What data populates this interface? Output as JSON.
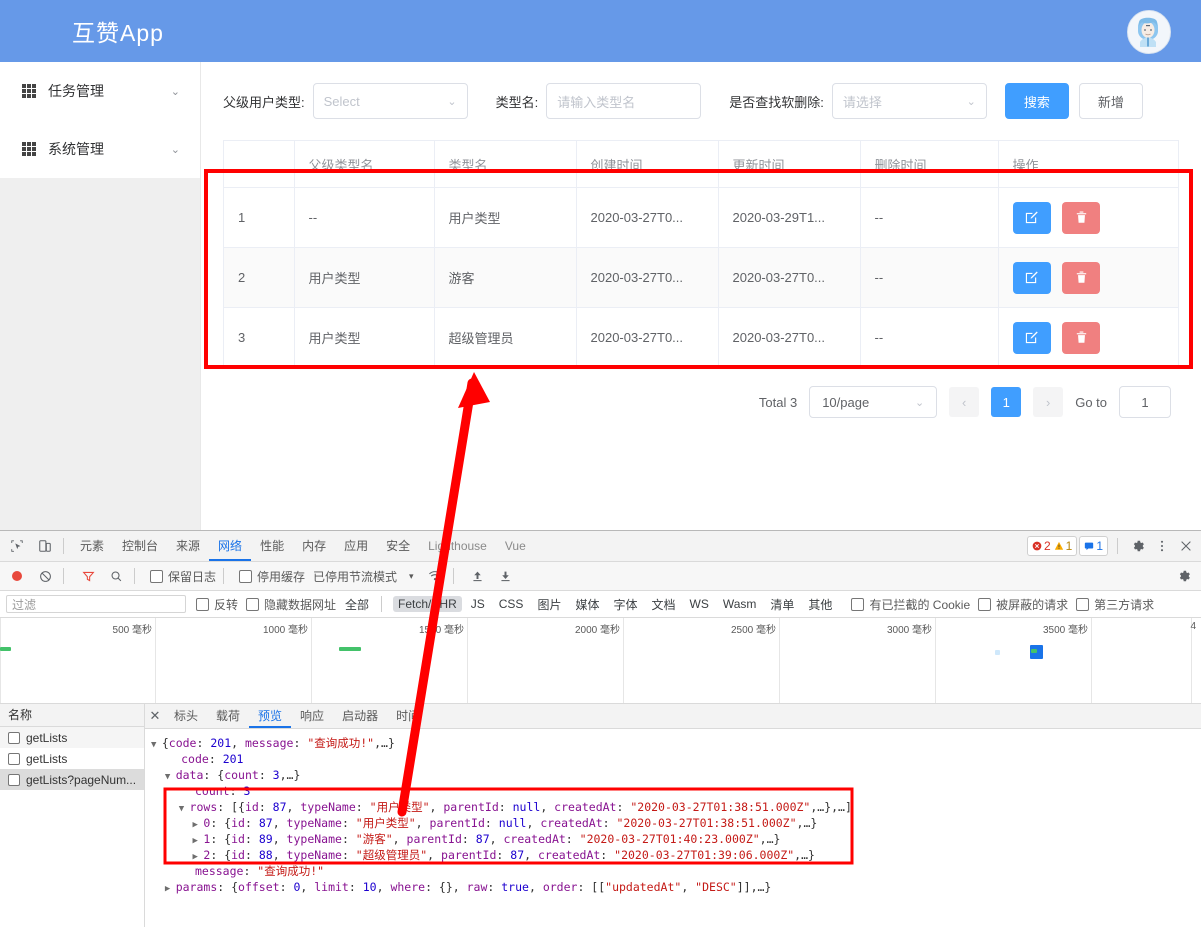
{
  "app": {
    "title": "互赞App",
    "avatar_icon": "user-avatar-icon"
  },
  "sidebar": {
    "items": [
      {
        "label": "任务管理",
        "icon": "grid-icon",
        "arrow": "⌄"
      },
      {
        "label": "系统管理",
        "icon": "grid-icon",
        "arrow": "⌄"
      }
    ]
  },
  "filters": {
    "parent_type_label": "父级用户类型:",
    "parent_type_value": "Select",
    "type_name_label": "类型名:",
    "type_name_placeholder": "请输入类型名",
    "soft_delete_label": "是否查找软删除:",
    "soft_delete_value": "请选择",
    "search_button": "搜索",
    "add_button": "新增"
  },
  "table": {
    "headers": [
      "",
      "父级类型名",
      "类型名",
      "创建时间",
      "更新时间",
      "删除时间",
      "操作"
    ],
    "rows": [
      {
        "idx": "1",
        "parent": "--",
        "name": "用户类型",
        "created": "2020-03-27T0...",
        "updated": "2020-03-29T1...",
        "deleted": "--"
      },
      {
        "idx": "2",
        "parent": "用户类型",
        "name": "游客",
        "created": "2020-03-27T0...",
        "updated": "2020-03-27T0...",
        "deleted": "--"
      },
      {
        "idx": "3",
        "parent": "用户类型",
        "name": "超级管理员",
        "created": "2020-03-27T0...",
        "updated": "2020-03-27T0...",
        "deleted": "--"
      }
    ],
    "edit_icon": "edit-icon",
    "delete_icon": "trash-icon"
  },
  "pagination": {
    "total": "Total 3",
    "page_size": "10/page",
    "prev": "‹",
    "current_page": "1",
    "next": "›",
    "goto_label": "Go to",
    "goto_value": "1"
  },
  "devtools": {
    "tabs": [
      {
        "label": "元素",
        "active": false,
        "muted": false
      },
      {
        "label": "控制台",
        "active": false,
        "muted": false
      },
      {
        "label": "来源",
        "active": false,
        "muted": false
      },
      {
        "label": "网络",
        "active": true,
        "muted": false
      },
      {
        "label": "性能",
        "active": false,
        "muted": false
      },
      {
        "label": "内存",
        "active": false,
        "muted": false
      },
      {
        "label": "应用",
        "active": false,
        "muted": false
      },
      {
        "label": "安全",
        "active": false,
        "muted": false
      },
      {
        "label": "Lighthouse",
        "active": false,
        "muted": true
      },
      {
        "label": "Vue",
        "active": false,
        "muted": true
      }
    ],
    "badges": {
      "errors": "2",
      "warnings": "1",
      "messages": "1"
    },
    "icons": {
      "inspect": "inspect-element-icon",
      "device": "device-toolbar-icon",
      "settings": "gear-icon",
      "more": "kebab-menu-icon",
      "close": "close-icon",
      "record": "record-icon",
      "clear": "clear-icon",
      "filter": "filter-icon",
      "search": "search-icon",
      "throttle": "network-conditions-icon",
      "import": "import-har-icon",
      "export": "export-har-icon",
      "panel_settings": "gear-icon"
    },
    "controls": {
      "preserve_log": "保留日志",
      "disable_cache": "停用缓存",
      "throttling": "已停用节流模式",
      "throttle_caret": "▾"
    },
    "filterbar": {
      "filter_placeholder": "过滤",
      "invert": "反转",
      "hide_data_urls": "隐藏数据网址",
      "types": [
        "全部",
        "Fetch/XHR",
        "JS",
        "CSS",
        "图片",
        "媒体",
        "字体",
        "文档",
        "WS",
        "Wasm",
        "清单",
        "其他"
      ],
      "selected_type": "Fetch/XHR",
      "blocked_cookies": "有已拦截的 Cookie",
      "blocked_requests": "被屏蔽的请求",
      "third_party": "第三方请求"
    },
    "timeline": {
      "labels": [
        "500 毫秒",
        "1000 毫秒",
        "1500 毫秒",
        "2000 毫秒",
        "2500 毫秒",
        "3000 毫秒",
        "3500 毫秒",
        "4"
      ]
    },
    "requests": {
      "header": "名称",
      "items": [
        {
          "name": "getLists",
          "selected": false
        },
        {
          "name": "getLists",
          "selected": false
        },
        {
          "name": "getLists?pageNum...",
          "selected": true
        }
      ]
    },
    "detail_tabs": [
      {
        "label": "标头",
        "active": false
      },
      {
        "label": "载荷",
        "active": false
      },
      {
        "label": "预览",
        "active": true
      },
      {
        "label": "响应",
        "active": false
      },
      {
        "label": "启动器",
        "active": false
      },
      {
        "label": "时间",
        "active": false
      }
    ],
    "preview_json": [
      {
        "indent": 0,
        "tri": "▼",
        "parts": [
          {
            "t": "{",
            "c": "pl"
          },
          {
            "t": "code",
            "c": "k"
          },
          {
            "t": ": ",
            "c": "pl"
          },
          {
            "t": "201",
            "c": "num"
          },
          {
            "t": ", ",
            "c": "pl"
          },
          {
            "t": "message",
            "c": "k"
          },
          {
            "t": ": ",
            "c": "pl"
          },
          {
            "t": "\"查询成功!\"",
            "c": "str"
          },
          {
            "t": ",…}",
            "c": "pl"
          }
        ]
      },
      {
        "indent": 1,
        "tri": "",
        "parts": [
          {
            "t": "code",
            "c": "k"
          },
          {
            "t": ": ",
            "c": "pl"
          },
          {
            "t": "201",
            "c": "num"
          }
        ]
      },
      {
        "indent": 1,
        "tri": "▼",
        "parts": [
          {
            "t": "data",
            "c": "k"
          },
          {
            "t": ": {",
            "c": "pl"
          },
          {
            "t": "count",
            "c": "k"
          },
          {
            "t": ": ",
            "c": "pl"
          },
          {
            "t": "3",
            "c": "num"
          },
          {
            "t": ",…}",
            "c": "pl"
          }
        ]
      },
      {
        "indent": 2,
        "tri": "",
        "parts": [
          {
            "t": "count",
            "c": "k"
          },
          {
            "t": ": ",
            "c": "pl"
          },
          {
            "t": "3",
            "c": "num"
          }
        ]
      },
      {
        "indent": 2,
        "tri": "▼",
        "parts": [
          {
            "t": "rows",
            "c": "k"
          },
          {
            "t": ": [{",
            "c": "pl"
          },
          {
            "t": "id",
            "c": "k"
          },
          {
            "t": ": ",
            "c": "pl"
          },
          {
            "t": "87",
            "c": "num"
          },
          {
            "t": ", ",
            "c": "pl"
          },
          {
            "t": "typeName",
            "c": "k"
          },
          {
            "t": ": ",
            "c": "pl"
          },
          {
            "t": "\"用户类型\"",
            "c": "str"
          },
          {
            "t": ", ",
            "c": "pl"
          },
          {
            "t": "parentId",
            "c": "k"
          },
          {
            "t": ": ",
            "c": "pl"
          },
          {
            "t": "null",
            "c": "nul"
          },
          {
            "t": ", ",
            "c": "pl"
          },
          {
            "t": "createdAt",
            "c": "k"
          },
          {
            "t": ": ",
            "c": "pl"
          },
          {
            "t": "\"2020-03-27T01:38:51.000Z\"",
            "c": "str"
          },
          {
            "t": ",…},…]",
            "c": "pl"
          }
        ]
      },
      {
        "indent": 3,
        "tri": "▶",
        "parts": [
          {
            "t": "0",
            "c": "k"
          },
          {
            "t": ": {",
            "c": "pl"
          },
          {
            "t": "id",
            "c": "k"
          },
          {
            "t": ": ",
            "c": "pl"
          },
          {
            "t": "87",
            "c": "num"
          },
          {
            "t": ", ",
            "c": "pl"
          },
          {
            "t": "typeName",
            "c": "k"
          },
          {
            "t": ": ",
            "c": "pl"
          },
          {
            "t": "\"用户类型\"",
            "c": "str"
          },
          {
            "t": ", ",
            "c": "pl"
          },
          {
            "t": "parentId",
            "c": "k"
          },
          {
            "t": ": ",
            "c": "pl"
          },
          {
            "t": "null",
            "c": "nul"
          },
          {
            "t": ", ",
            "c": "pl"
          },
          {
            "t": "createdAt",
            "c": "k"
          },
          {
            "t": ": ",
            "c": "pl"
          },
          {
            "t": "\"2020-03-27T01:38:51.000Z\"",
            "c": "str"
          },
          {
            "t": ",…}",
            "c": "pl"
          }
        ]
      },
      {
        "indent": 3,
        "tri": "▶",
        "parts": [
          {
            "t": "1",
            "c": "k"
          },
          {
            "t": ": {",
            "c": "pl"
          },
          {
            "t": "id",
            "c": "k"
          },
          {
            "t": ": ",
            "c": "pl"
          },
          {
            "t": "89",
            "c": "num"
          },
          {
            "t": ", ",
            "c": "pl"
          },
          {
            "t": "typeName",
            "c": "k"
          },
          {
            "t": ": ",
            "c": "pl"
          },
          {
            "t": "\"游客\"",
            "c": "str"
          },
          {
            "t": ", ",
            "c": "pl"
          },
          {
            "t": "parentId",
            "c": "k"
          },
          {
            "t": ": ",
            "c": "pl"
          },
          {
            "t": "87",
            "c": "num"
          },
          {
            "t": ", ",
            "c": "pl"
          },
          {
            "t": "createdAt",
            "c": "k"
          },
          {
            "t": ": ",
            "c": "pl"
          },
          {
            "t": "\"2020-03-27T01:40:23.000Z\"",
            "c": "str"
          },
          {
            "t": ",…}",
            "c": "pl"
          }
        ]
      },
      {
        "indent": 3,
        "tri": "▶",
        "parts": [
          {
            "t": "2",
            "c": "k"
          },
          {
            "t": ": {",
            "c": "pl"
          },
          {
            "t": "id",
            "c": "k"
          },
          {
            "t": ": ",
            "c": "pl"
          },
          {
            "t": "88",
            "c": "num"
          },
          {
            "t": ", ",
            "c": "pl"
          },
          {
            "t": "typeName",
            "c": "k"
          },
          {
            "t": ": ",
            "c": "pl"
          },
          {
            "t": "\"超级管理员\"",
            "c": "str"
          },
          {
            "t": ", ",
            "c": "pl"
          },
          {
            "t": "parentId",
            "c": "k"
          },
          {
            "t": ": ",
            "c": "pl"
          },
          {
            "t": "87",
            "c": "num"
          },
          {
            "t": ", ",
            "c": "pl"
          },
          {
            "t": "createdAt",
            "c": "k"
          },
          {
            "t": ": ",
            "c": "pl"
          },
          {
            "t": "\"2020-03-27T01:39:06.000Z\"",
            "c": "str"
          },
          {
            "t": ",…}",
            "c": "pl"
          }
        ]
      },
      {
        "indent": 2,
        "tri": "",
        "parts": [
          {
            "t": "message",
            "c": "k"
          },
          {
            "t": ": ",
            "c": "pl"
          },
          {
            "t": "\"查询成功!\"",
            "c": "str"
          }
        ]
      },
      {
        "indent": 1,
        "tri": "▶",
        "parts": [
          {
            "t": "params",
            "c": "k"
          },
          {
            "t": ": {",
            "c": "pl"
          },
          {
            "t": "offset",
            "c": "k"
          },
          {
            "t": ": ",
            "c": "pl"
          },
          {
            "t": "0",
            "c": "num"
          },
          {
            "t": ", ",
            "c": "pl"
          },
          {
            "t": "limit",
            "c": "k"
          },
          {
            "t": ": ",
            "c": "pl"
          },
          {
            "t": "10",
            "c": "num"
          },
          {
            "t": ", ",
            "c": "pl"
          },
          {
            "t": "where",
            "c": "k"
          },
          {
            "t": ": {}, ",
            "c": "pl"
          },
          {
            "t": "raw",
            "c": "k"
          },
          {
            "t": ": ",
            "c": "pl"
          },
          {
            "t": "true",
            "c": "bool"
          },
          {
            "t": ", ",
            "c": "pl"
          },
          {
            "t": "order",
            "c": "k"
          },
          {
            "t": ": [[",
            "c": "pl"
          },
          {
            "t": "\"updatedAt\"",
            "c": "str"
          },
          {
            "t": ", ",
            "c": "pl"
          },
          {
            "t": "\"DESC\"",
            "c": "str"
          },
          {
            "t": "]],…}",
            "c": "pl"
          }
        ]
      }
    ]
  },
  "annotations": {
    "highlight_color": "#ff0000",
    "arrow_name": "red-annotation-arrow",
    "table_box_name": "red-highlight-box-table",
    "json_box_name": "red-highlight-box-json"
  },
  "colors": {
    "brand": "#6699e8",
    "primary": "#409eff",
    "danger": "#f08080",
    "accent_devtools": "#1a73e8"
  }
}
